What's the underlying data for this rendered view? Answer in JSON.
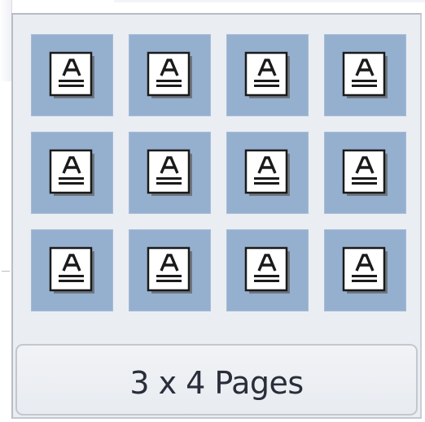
{
  "layout_picker": {
    "grid_columns": 4,
    "grid_rows": 3,
    "selection_label": "3 x 4 Pages",
    "cell_icon": "page-with-letter-a-icon",
    "colors": {
      "panel_background": "#eaedf2",
      "cell_highlight": "#95b0cf",
      "label_text": "#2a2d3a"
    }
  }
}
